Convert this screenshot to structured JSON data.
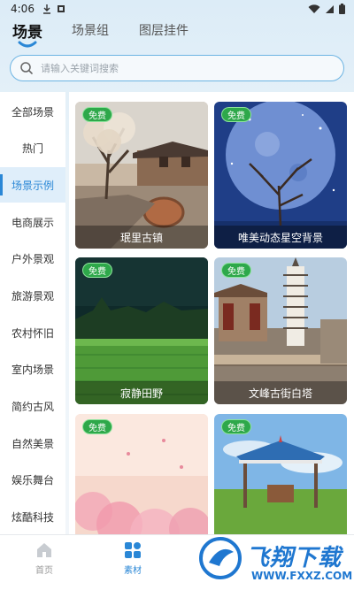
{
  "status_bar": {
    "time": "4:06",
    "icons_left": [
      "download-icon",
      "media-icon"
    ],
    "icons_right": [
      "wifi-icon",
      "signal-icon",
      "battery-icon"
    ]
  },
  "top_tabs": [
    {
      "label": "场景",
      "active": true
    },
    {
      "label": "场景组",
      "active": false
    },
    {
      "label": "图层挂件",
      "active": false
    }
  ],
  "search": {
    "placeholder": "请输入关键词搜索",
    "value": ""
  },
  "sidebar": {
    "items": [
      {
        "label": "全部场景",
        "active": false
      },
      {
        "label": "热门",
        "active": false
      },
      {
        "label": "场景示例",
        "active": true
      },
      {
        "label": "电商展示",
        "active": false
      },
      {
        "label": "户外景观",
        "active": false
      },
      {
        "label": "旅游景观",
        "active": false
      },
      {
        "label": "农村怀旧",
        "active": false
      },
      {
        "label": "室内场景",
        "active": false
      },
      {
        "label": "简约古风",
        "active": false
      },
      {
        "label": "自然美景",
        "active": false
      },
      {
        "label": "娱乐舞台",
        "active": false
      },
      {
        "label": "炫酷科技",
        "active": false
      }
    ]
  },
  "cards": [
    {
      "badge": "免费",
      "caption": "珉里古镇",
      "scene": "ancient-town"
    },
    {
      "badge": "免费",
      "caption": "唯美动态星空背景",
      "scene": "starry-sky"
    },
    {
      "badge": "免费",
      "caption": "寂静田野",
      "scene": "quiet-field"
    },
    {
      "badge": "免费",
      "caption": "文峰古街白塔",
      "scene": "white-pagoda"
    },
    {
      "badge": "免费",
      "caption": "",
      "scene": "pink-blossom"
    },
    {
      "badge": "免费",
      "caption": "",
      "scene": "grassland-pavilion"
    }
  ],
  "bottom_nav": [
    {
      "label": "首页",
      "icon": "home-icon",
      "active": false
    },
    {
      "label": "素材",
      "icon": "materials-icon",
      "active": true
    }
  ],
  "watermark": {
    "text": "飞翔下载",
    "url": "WWW.FXXZ.COM"
  },
  "colors": {
    "accent": "#2a87d6",
    "badge_green": "#2ea84a",
    "search_border": "#6db4e3"
  }
}
